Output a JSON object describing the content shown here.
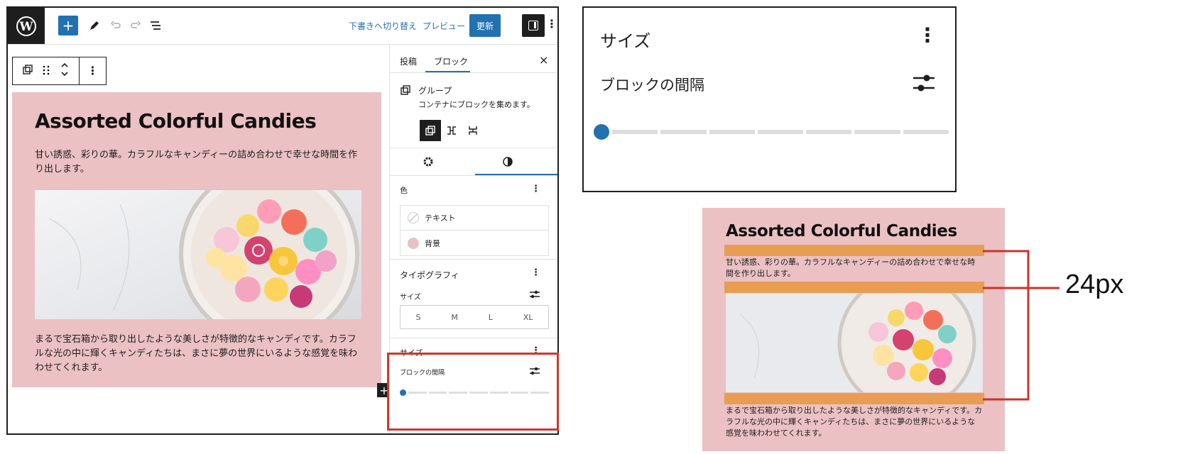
{
  "editor": {
    "topbar": {
      "draft_switch": "下書きへ切り替え",
      "preview": "プレビュー",
      "update": "更新"
    },
    "canvas": {
      "title": "Assorted Colorful Candies",
      "paragraph1": "甘い誘惑、彩りの華。カラフルなキャンディーの詰め合わせで幸せな時間を作り出します。",
      "paragraph2": "まるで宝石箱から取り出したような美しさが特徴的なキャンディです。カラフルな光の中に輝くキャンディたちは、まさに夢の世界にいるような感覚を味わわせてくれます。",
      "inserter": "+"
    },
    "sidebar": {
      "tabs": [
        "投稿",
        "ブロック"
      ],
      "close": "×",
      "block_name": "グループ",
      "block_desc": "コンテナにブロックを集めます。",
      "color_section": "色",
      "color_items": [
        {
          "label": "テキスト",
          "color": "#ffffff"
        },
        {
          "label": "背景",
          "color": "#ebc1c3"
        }
      ],
      "typography_section": "タイポグラフィ",
      "size_label": "サイズ",
      "size_options": [
        "S",
        "M",
        "L",
        "XL"
      ],
      "dimensions_section": "サイズ",
      "block_spacing_label": "ブロックの間隔"
    }
  },
  "zoom": {
    "size_label": "サイズ",
    "block_spacing_label": "ブロックの間隔"
  },
  "preview": {
    "title": "Assorted Colorful Candies",
    "paragraph1": "甘い誘惑、彩りの華。カラフルなキャンディーの詰め合わせで幸せな時間を作り出します。",
    "paragraph2": "まるで宝石箱から取り出したような美しさが特徴的なキャンディです。カラフルな光の中に輝くキャンディたちは、まさに夢の世界にいるような感覚を味わわせてくれます。"
  },
  "annotation": {
    "gap_value": "24px"
  },
  "colors": {
    "accent": "#2271b1",
    "group_bg": "#ebc1c3",
    "highlight": "#cc3a2a",
    "gap_bar": "#e99d52"
  }
}
